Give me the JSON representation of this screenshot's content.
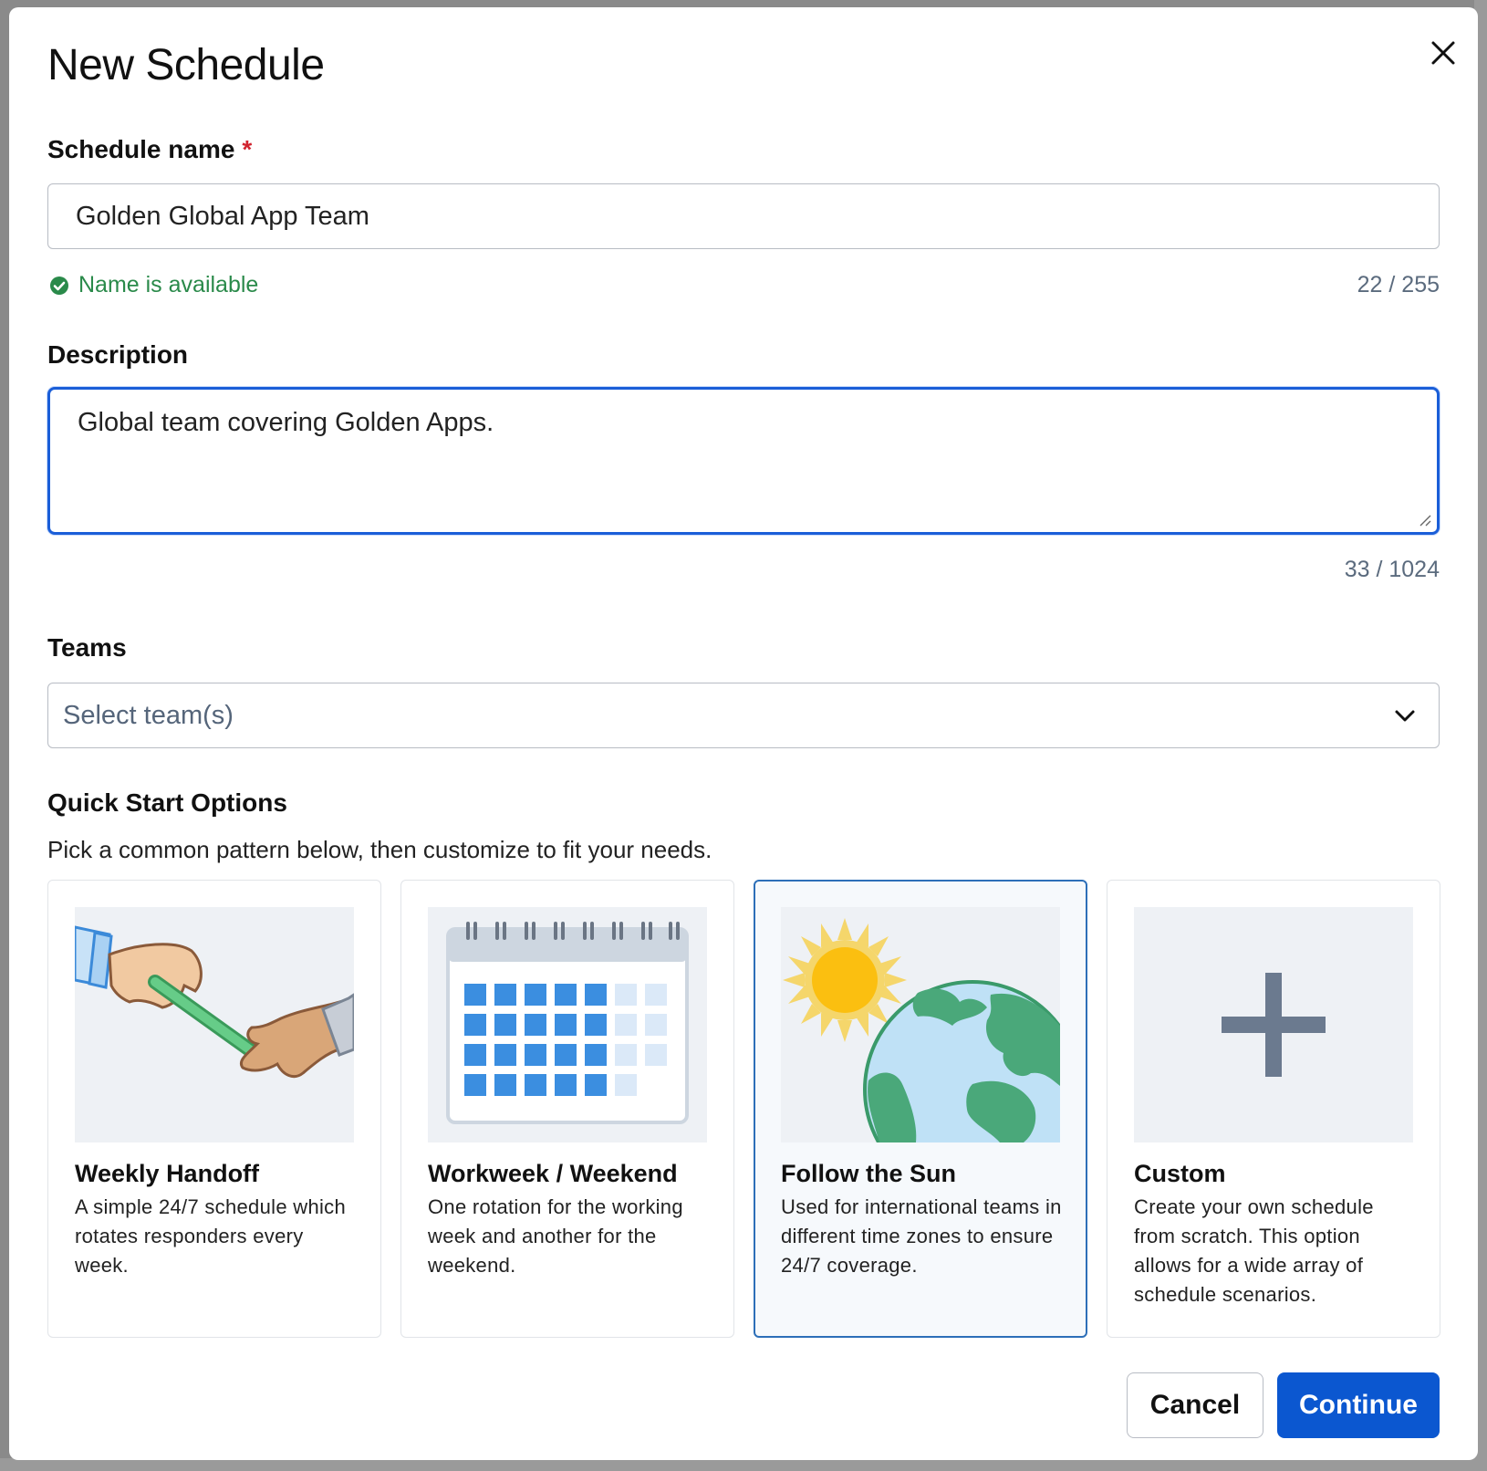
{
  "dialog": {
    "title": "New Schedule",
    "close_icon": "close-icon"
  },
  "schedule_name": {
    "label": "Schedule name",
    "required_mark": "*",
    "value": "Golden Global App Team",
    "status": "Name is available",
    "status_icon": "check-circle-icon",
    "count": "22 / 255"
  },
  "description": {
    "label": "Description",
    "value": "Global team covering Golden Apps.",
    "count": "33 / 1024"
  },
  "teams": {
    "label": "Teams",
    "placeholder": "Select team(s)",
    "icon": "chevron-down-icon"
  },
  "quick_start": {
    "heading": "Quick Start Options",
    "subtitle": "Pick a common pattern below, then customize to fit your needs.",
    "options": [
      {
        "title": "Weekly Handoff",
        "description": "A simple 24/7 schedule which rotates responders every week.",
        "icon": "baton-handoff-icon",
        "selected": false
      },
      {
        "title": "Workweek / Weekend",
        "description": "One rotation for the working week and another for the weekend.",
        "icon": "calendar-icon",
        "selected": false
      },
      {
        "title": "Follow the Sun",
        "description": "Used for international teams in different time zones to ensure 24/7 coverage.",
        "icon": "sun-globe-icon",
        "selected": true
      },
      {
        "title": "Custom",
        "description": "Create your own schedule from scratch. This option allows for a wide array of schedule scenarios.",
        "icon": "plus-icon",
        "selected": false
      }
    ]
  },
  "footer": {
    "cancel_label": "Cancel",
    "continue_label": "Continue"
  },
  "colors": {
    "primary": "#0b57d0",
    "focus_border": "#1a5ed8",
    "success": "#2a8a4a",
    "required": "#d1242f",
    "selected_card_border": "#2d6fb8"
  }
}
